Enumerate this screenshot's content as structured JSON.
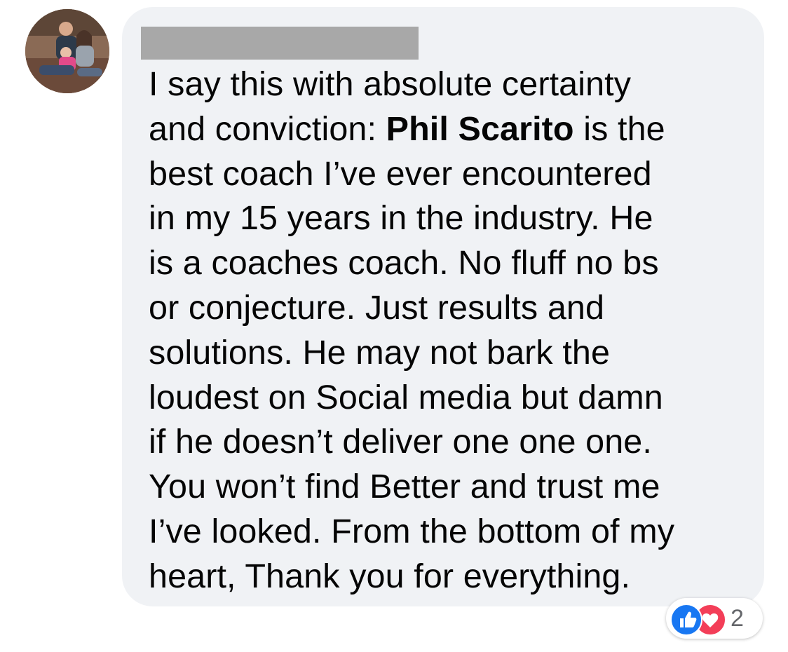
{
  "comment": {
    "author_name": "",
    "text_lines": [
      [
        "I say this with absolute certainty",
        "",
        ""
      ],
      [
        "and conviction: ",
        "Phil Scarito",
        " is the"
      ],
      [
        "best coach I’ve ever encountered",
        "",
        ""
      ],
      [
        "in my 15 years in the industry. He",
        "",
        ""
      ],
      [
        "is a coaches coach. No fluff no bs",
        "",
        ""
      ],
      [
        "or conjecture. Just results and",
        "",
        ""
      ],
      [
        "solutions. He may not bark the",
        "",
        ""
      ],
      [
        "loudest on Social media but damn",
        "",
        ""
      ],
      [
        "if he doesn’t deliver one one one.",
        "",
        ""
      ],
      [
        "You won’t find Better and trust me",
        "",
        ""
      ],
      [
        "I’ve looked. From the bottom of my",
        "",
        ""
      ],
      [
        "heart, Thank you for everything.",
        "",
        ""
      ]
    ]
  },
  "reactions": {
    "count": "2",
    "types": [
      "like-icon",
      "love-icon"
    ]
  },
  "colors": {
    "bubble_bg": "#f0f2f5",
    "text": "#050505",
    "like_blue": "#1877f2",
    "love_red": "#f33e58",
    "count_gray": "#65676b",
    "redaction_gray": "#a8a8a8"
  }
}
